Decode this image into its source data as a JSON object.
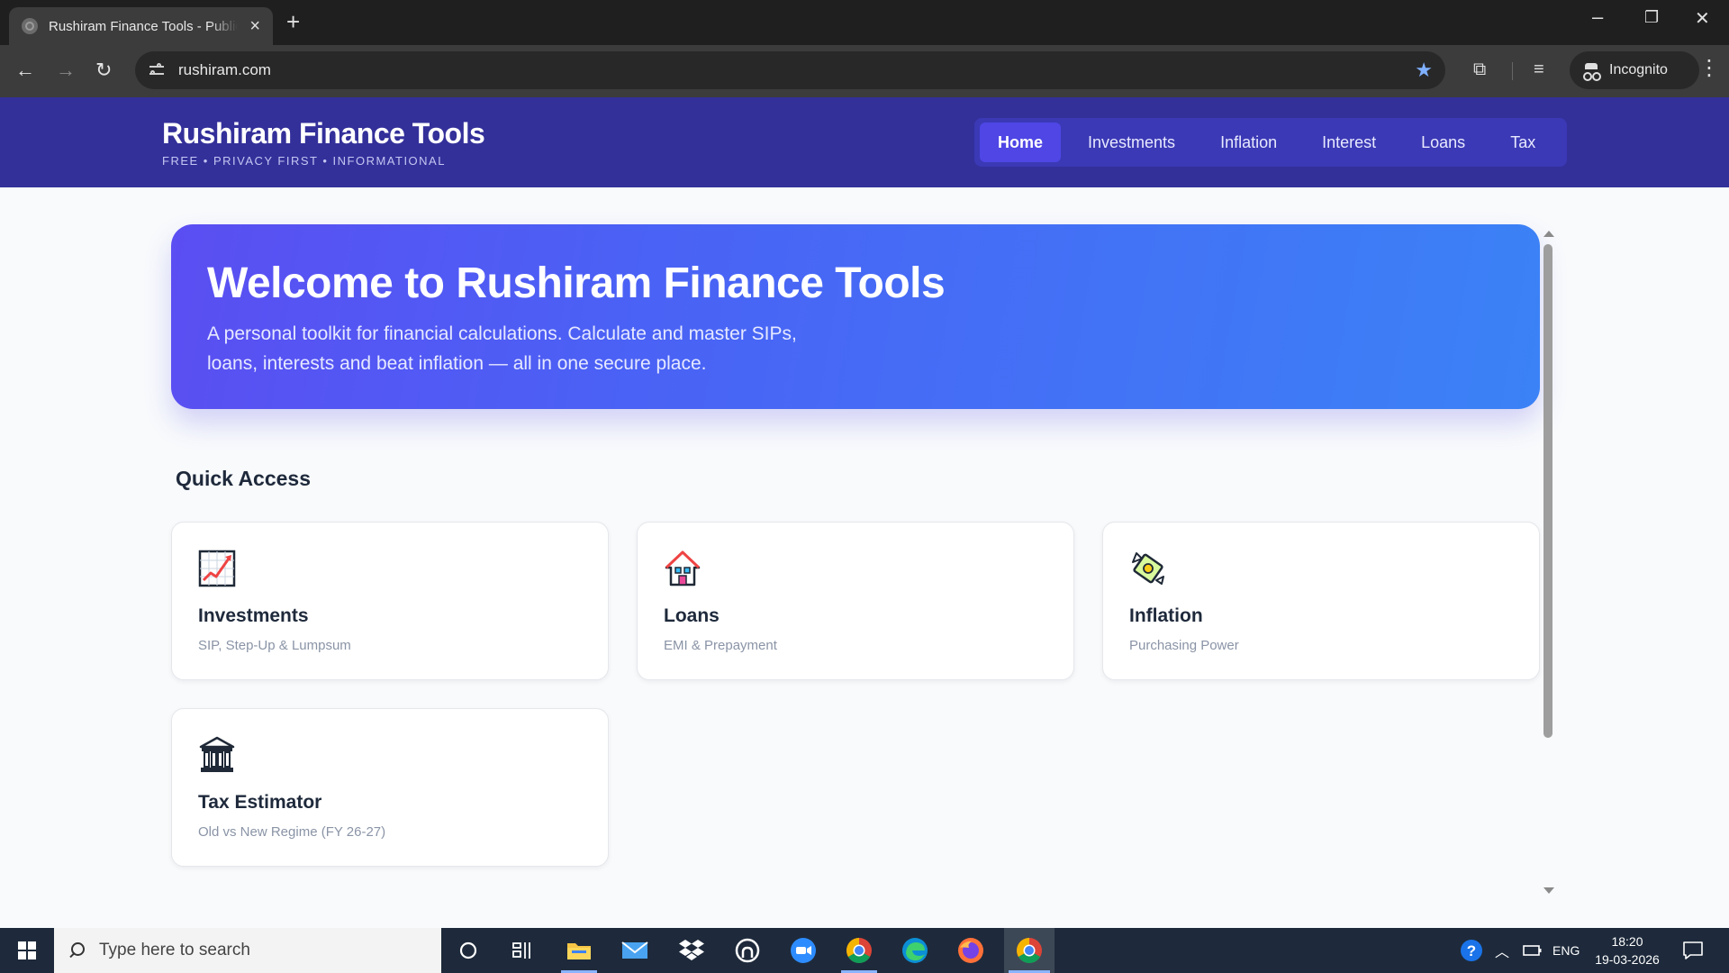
{
  "browser": {
    "tab_title": "Rushiram Finance Tools - Public",
    "url": "rushiram.com",
    "incognito_label": "Incognito"
  },
  "site": {
    "brand_title": "Rushiram Finance Tools",
    "tagline": "FREE • PRIVACY FIRST • INFORMATIONAL",
    "nav": [
      {
        "label": "Home",
        "active": true
      },
      {
        "label": "Investments",
        "active": false
      },
      {
        "label": "Inflation",
        "active": false
      },
      {
        "label": "Interest",
        "active": false
      },
      {
        "label": "Loans",
        "active": false
      },
      {
        "label": "Tax",
        "active": false
      }
    ]
  },
  "hero": {
    "title": "Welcome to Rushiram Finance Tools",
    "subtitle": "A personal toolkit for financial calculations. Calculate and master SIPs, loans, interests and beat inflation — all in one secure place."
  },
  "quick_access": {
    "title": "Quick Access",
    "cards": [
      {
        "title": "Investments",
        "desc": "SIP, Step-Up & Lumpsum",
        "icon": "chart-increasing-icon"
      },
      {
        "title": "Loans",
        "desc": "EMI & Prepayment",
        "icon": "house-icon"
      },
      {
        "title": "Inflation",
        "desc": "Purchasing Power",
        "icon": "money-with-wings-icon"
      },
      {
        "title": "Tax Estimator",
        "desc": "Old vs New Regime (FY 26-27)",
        "icon": "bank-building-icon"
      }
    ]
  },
  "taskbar": {
    "search_placeholder": "Type here to search",
    "language": "ENG",
    "time": "18:20",
    "date": "19-03-2026"
  },
  "colors": {
    "header_bg": "#33309a",
    "nav_active": "#4f46e5",
    "hero_start": "#5b4ef2",
    "hero_end": "#3b82f6"
  }
}
